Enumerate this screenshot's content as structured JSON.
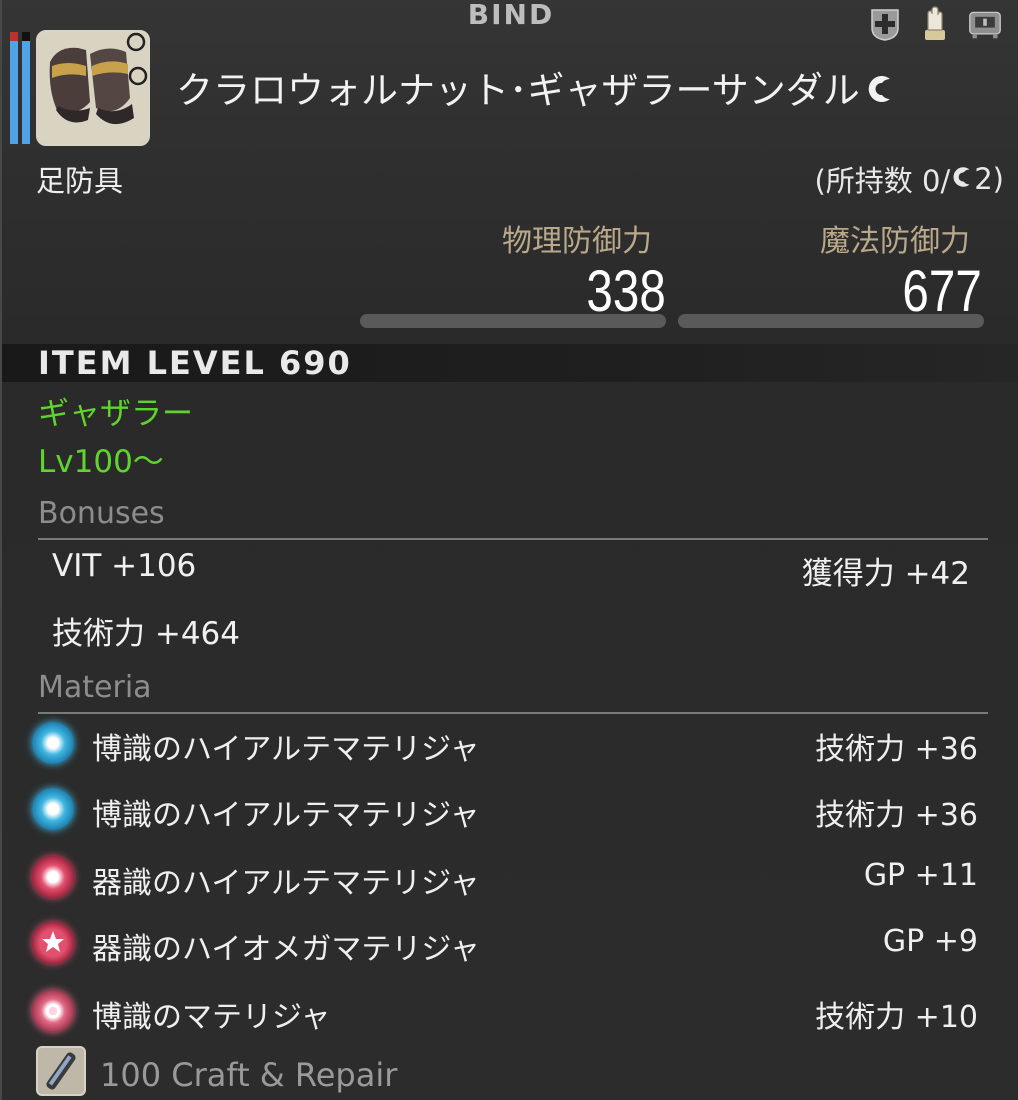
{
  "header": {
    "bind_label": "BIND",
    "icons": [
      "plus-shield-icon",
      "glove-icon",
      "armoire-icon"
    ]
  },
  "item": {
    "name": "クラロウォルナット･ギャザラーサンダル",
    "hq": true,
    "category": "足防具",
    "owned_text_prefix": "(所持数 0/",
    "owned_text_suffix": " 2)"
  },
  "defense": {
    "physical_label": "物理防御力",
    "physical_value": "338",
    "magic_label": "魔法防御力",
    "magic_value": "677"
  },
  "item_level": "ITEM LEVEL 690",
  "class_job": "ギャザラー",
  "level_req": "Lv100～",
  "bonuses": {
    "title": "Bonuses",
    "stats": [
      {
        "text": "VIT +106"
      },
      {
        "text": "獲得力 +42"
      },
      {
        "text": "技術力 +464"
      }
    ]
  },
  "materia": {
    "title": "Materia",
    "slots": [
      {
        "name": "博識のハイアルテマテリジャ",
        "value": "技術力 +36",
        "color": "#3fb6e0",
        "glow": "#1e7fb0",
        "type": "dot"
      },
      {
        "name": "博識のハイアルテマテリジャ",
        "value": "技術力 +36",
        "color": "#3fb6e0",
        "glow": "#1e7fb0",
        "type": "dot"
      },
      {
        "name": "器識のハイアルテマテリジャ",
        "value": "GP +11",
        "color": "#e2506f",
        "glow": "#a5243f",
        "type": "dot"
      },
      {
        "name": "器識のハイオメガマテリジャ",
        "value": "GP +9",
        "color": "#e2506f",
        "glow": "#a5243f",
        "type": "star"
      },
      {
        "name": "博識のマテリジャ",
        "value": "技術力 +10",
        "color": "#e26a86",
        "glow": "#a53651",
        "type": "ring"
      }
    ]
  },
  "repair": {
    "text": "100 Craft & Repair"
  }
}
